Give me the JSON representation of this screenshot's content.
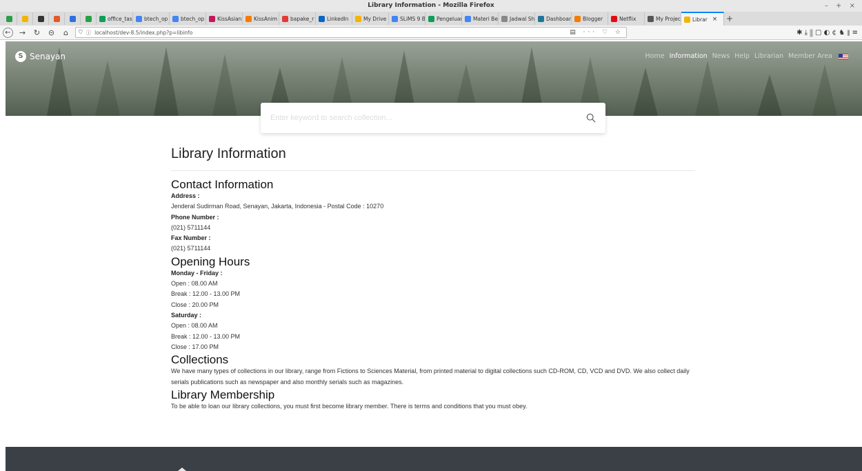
{
  "window": {
    "title": "Library Information - Mozilla Firefox",
    "controls": "– + ×"
  },
  "tabs": [
    {
      "label": "",
      "color": "#2e9d4a",
      "pinned": true
    },
    {
      "label": "",
      "color": "#f4b400",
      "pinned": true
    },
    {
      "label": "",
      "color": "#333333",
      "pinned": true
    },
    {
      "label": "",
      "color": "#e05a2b",
      "pinned": true
    },
    {
      "label": "",
      "color": "#2f6fde",
      "pinned": true
    },
    {
      "label": "",
      "color": "#25a244",
      "pinned": true
    },
    {
      "label": "office_tas",
      "color": "#0f9d58"
    },
    {
      "label": "btech_op",
      "color": "#4285f4"
    },
    {
      "label": "btech_op",
      "color": "#4285f4"
    },
    {
      "label": "KissAsian",
      "color": "#c2185b"
    },
    {
      "label": "KissAnim",
      "color": "#f57c00"
    },
    {
      "label": "bapake_r",
      "color": "#e53935"
    },
    {
      "label": "LinkedIn",
      "color": "#0a66c2"
    },
    {
      "label": "My Drive",
      "color": "#f4b400"
    },
    {
      "label": "SLiMS 9 B",
      "color": "#4285f4"
    },
    {
      "label": "Pengeluar",
      "color": "#0f9d58"
    },
    {
      "label": "Materi Be",
      "color": "#4285f4"
    },
    {
      "label": "Jadwal Sh",
      "color": "#888888"
    },
    {
      "label": "Dashboar",
      "color": "#21759b"
    },
    {
      "label": "Blogger",
      "color": "#f57c00"
    },
    {
      "label": "Netflix",
      "color": "#e50914"
    },
    {
      "label": "My Projec",
      "color": "#555555"
    },
    {
      "label": "Librar",
      "color": "#f4b400",
      "active": true
    }
  ],
  "navbar": {
    "url": "localhost/dev-8.5/index.php?p=libinfo",
    "url_icons": "▤ ··· ♡ ☆",
    "toolbar_icons": "✱ ⤓ ⫼ ▢ ◐ ¢ ♞ ⫴ ≡"
  },
  "site": {
    "brand": "Senayan",
    "nav": [
      {
        "label": "Home",
        "active": false
      },
      {
        "label": "Information",
        "active": true
      },
      {
        "label": "News",
        "active": false
      },
      {
        "label": "Help",
        "active": false
      },
      {
        "label": "Librarian",
        "active": false
      },
      {
        "label": "Member Area",
        "active": false
      }
    ],
    "search_placeholder": "Enter keyword to search collection..."
  },
  "content": {
    "title": "Library Information",
    "contact": {
      "heading": "Contact Information",
      "address_label": "Address :",
      "address": "Jenderal Sudirman Road, Senayan, Jakarta, Indonesia - Postal Code : 10270",
      "phone_label": "Phone Number :",
      "phone": "(021) 5711144",
      "fax_label": "Fax Number :",
      "fax": "(021) 5711144"
    },
    "hours": {
      "heading": "Opening Hours",
      "weekday_label": "Monday - Friday :",
      "weekday_open": "Open : 08.00 AM",
      "weekday_break": "Break : 12.00 - 13.00 PM",
      "weekday_close": "Close : 20.00 PM",
      "saturday_label": "Saturday :",
      "saturday_open": "Open : 08.00 AM",
      "saturday_break": "Break : 12.00 - 13.00 PM",
      "saturday_close": "Close : 17.00 PM"
    },
    "collections": {
      "heading": "Collections",
      "text": "We have many types of collections in our library, range from Fictions to Sciences Material, from printed material to digital collections such CD-ROM, CD, VCD and DVD. We also collect daily serials publications such as newspaper and also monthly serials such as magazines."
    },
    "membership": {
      "heading": "Library Membership",
      "text": "To be able to loan our library collections, you must first become library member. There is terms and conditions that you must obey."
    }
  }
}
